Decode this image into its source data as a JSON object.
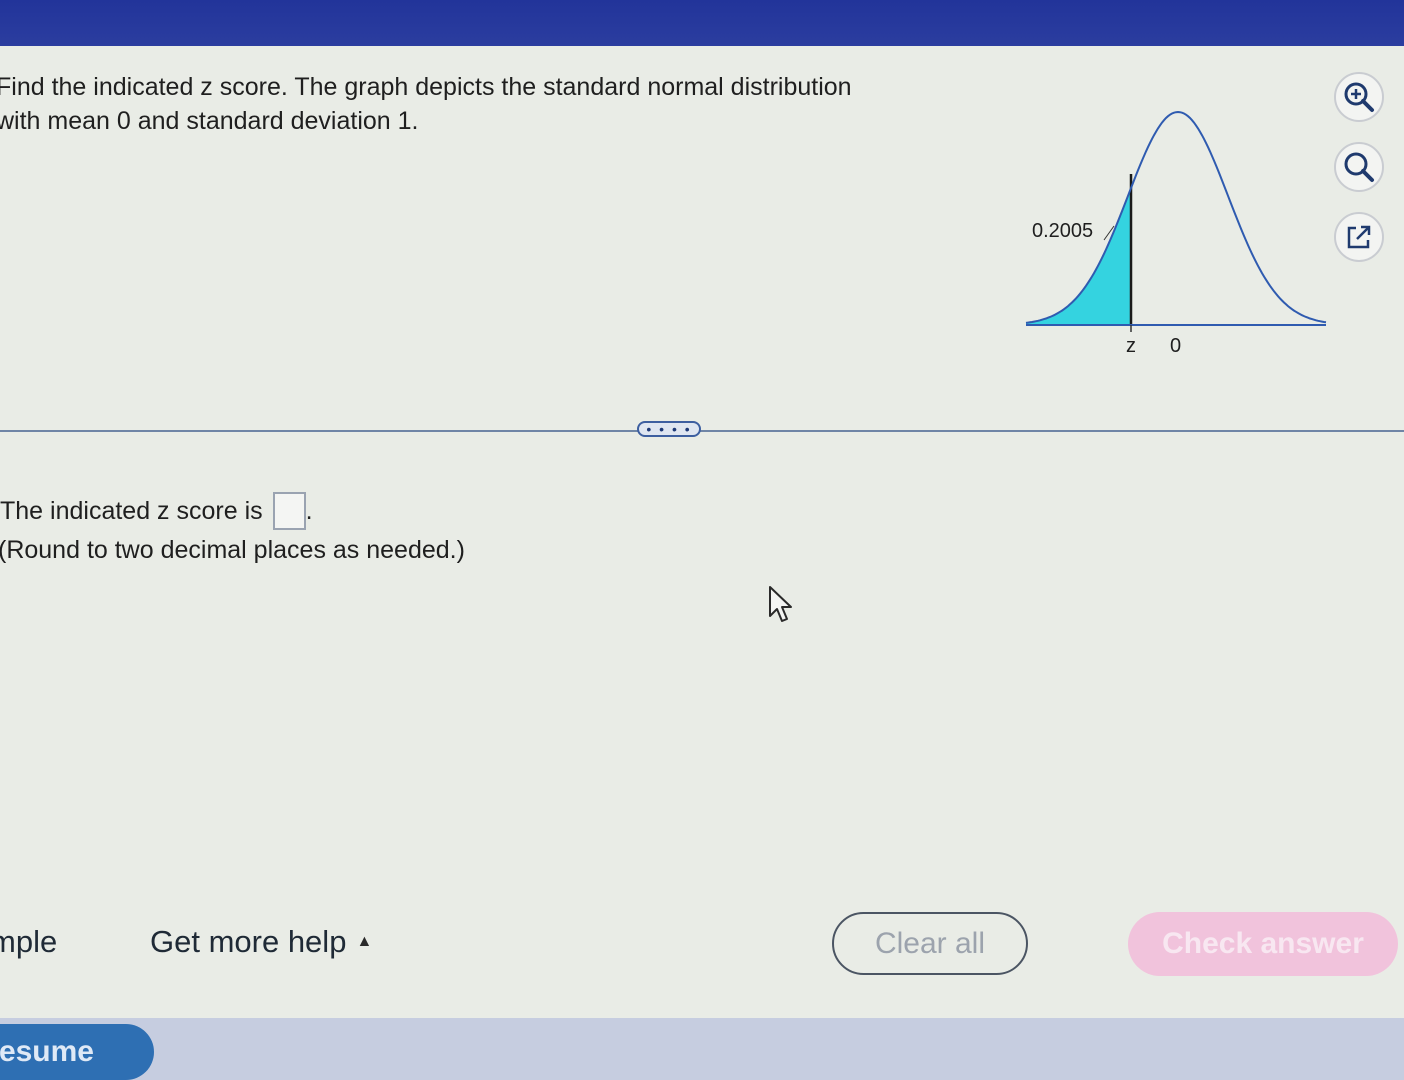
{
  "question": {
    "line1": "Find the indicated z score. The graph depicts the standard normal distribution",
    "line2": "with mean 0 and standard deviation 1."
  },
  "graph": {
    "area_label": "0.2005",
    "z_label": "z",
    "zero_label": "0",
    "shaded_area": 0.2005,
    "fill_color": "#34d3e0",
    "curve_color": "#2f5bb0"
  },
  "tools": {
    "zoom_in": "zoom-in-icon",
    "zoom_out": "zoom-out-icon",
    "popout": "external-link-icon"
  },
  "expand_handle": {
    "label": "• • • •"
  },
  "answer": {
    "prefix": "The indicated z score is",
    "suffix": ".",
    "value": "",
    "hint": "(Round to two decimal places as needed.)"
  },
  "bottom": {
    "example": "mple",
    "help": "Get more help",
    "help_caret": "▲",
    "clear": "Clear all",
    "check": "Check answer"
  },
  "footer": {
    "resume": "esume"
  }
}
